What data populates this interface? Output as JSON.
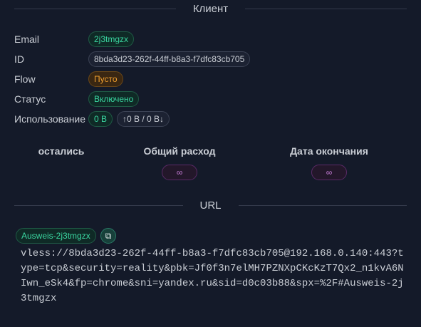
{
  "client_header": "Клиент",
  "fields": {
    "email_label": "Email",
    "email": "2j3tmgzx",
    "id_label": "ID",
    "id": "8bda3d23-262f-44ff-b8a3-f7dfc83cb705",
    "flow_label": "Flow",
    "flow": "Пусто",
    "status_label": "Статус",
    "status": "Включено",
    "usage_label": "Использование",
    "usage_total": "0 B",
    "usage_updown": "↑0 B / 0 B↓"
  },
  "stats": {
    "remaining_label": "остались",
    "total_label": "Общий расход",
    "total_value": "∞",
    "expiry_label": "Дата окончания",
    "expiry_value": "∞"
  },
  "url_header": "URL",
  "link": {
    "tag": "Ausweis-2j3tmgzx",
    "copy_icon": "copy-icon",
    "url": "vless://8bda3d23-262f-44ff-b8a3-f7dfc83cb705@192.168.0.140:443?type=tcp&security=reality&pbk=Jf0f3n7elMH7PZNXpCKcKzT7Qx2_n1kvA6NIwn_eSk4&fp=chrome&sni=yandex.ru&sid=d0c03b88&spx=%2F#Ausweis-2j3tmgzx"
  }
}
